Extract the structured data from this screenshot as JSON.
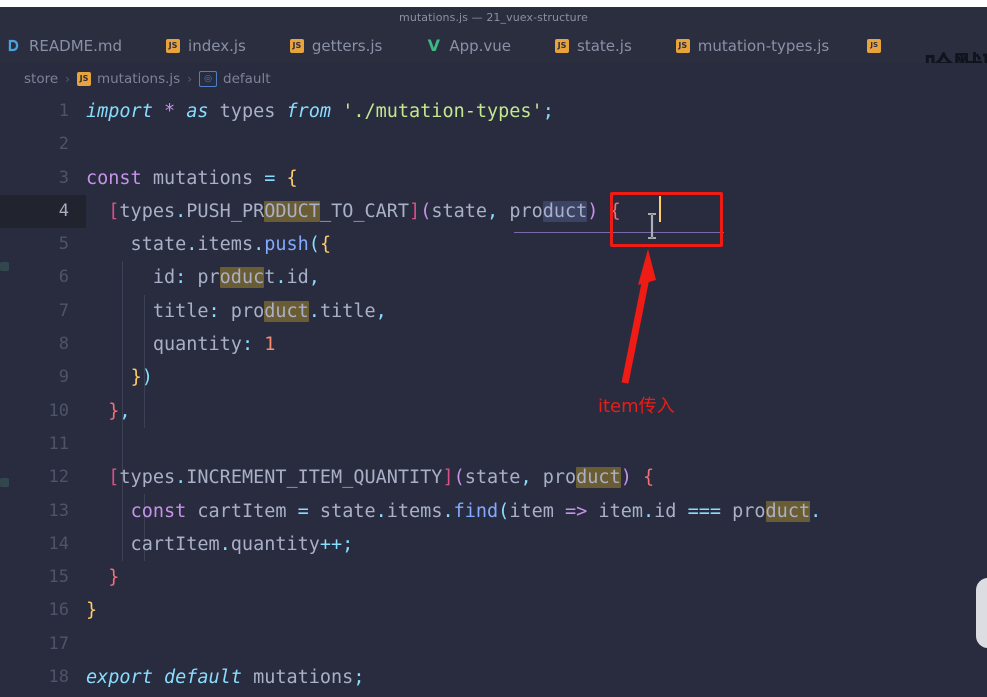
{
  "window": {
    "title": "mutations.js — 21_vuex-structure"
  },
  "tabs": [
    {
      "label": "README.md",
      "icon": "markdown-icon",
      "icon_text": "",
      "active": false
    },
    {
      "label": "index.js",
      "icon": "js-icon",
      "icon_text": "JS",
      "active": false
    },
    {
      "label": "getters.js",
      "icon": "js-icon",
      "icon_text": "JS",
      "active": false
    },
    {
      "label": "App.vue",
      "icon": "vue-icon",
      "icon_text": "V",
      "active": false
    },
    {
      "label": "state.js",
      "icon": "js-icon",
      "icon_text": "JS",
      "active": false
    },
    {
      "label": "mutation-types.js",
      "icon": "js-icon",
      "icon_text": "JS",
      "active": false
    }
  ],
  "breadcrumb": {
    "separator": "›",
    "items": [
      {
        "label": "store",
        "icon": ""
      },
      {
        "label": "mutations.js",
        "icon": "js-icon",
        "icon_text": "JS"
      },
      {
        "label": "default",
        "icon": "object-icon",
        "icon_text": "◎"
      }
    ]
  },
  "editor": {
    "current_line": 4,
    "first_visible_line": 1,
    "lines": [
      {
        "n": "1",
        "text": "import * as types from './mutation-types';"
      },
      {
        "n": "2",
        "text": ""
      },
      {
        "n": "3",
        "text": "const mutations = {"
      },
      {
        "n": "4",
        "text": "  [types.PUSH_PRODUCT_TO_CART](state, product) {"
      },
      {
        "n": "5",
        "text": "    state.items.push({"
      },
      {
        "n": "6",
        "text": "      id: product.id,"
      },
      {
        "n": "7",
        "text": "      title: product.title,"
      },
      {
        "n": "8",
        "text": "      quantity: 1"
      },
      {
        "n": "9",
        "text": "    })"
      },
      {
        "n": "10",
        "text": "  },"
      },
      {
        "n": "11",
        "text": ""
      },
      {
        "n": "12",
        "text": "  [types.INCREMENT_ITEM_QUANTITY](state, product) {"
      },
      {
        "n": "13",
        "text": "    const cartItem = state.items.find(item => item.id === product."
      },
      {
        "n": "14",
        "text": "    cartItem.quantity++;"
      },
      {
        "n": "15",
        "text": "  }"
      },
      {
        "n": "16",
        "text": "}"
      },
      {
        "n": "17",
        "text": ""
      },
      {
        "n": "18",
        "text": "export default mutations;"
      }
    ]
  },
  "annotation": {
    "label": "item传入",
    "color": "#ee1c15",
    "box_target": "product-parameter"
  },
  "watermark": {
    "text": "哈默聊"
  },
  "colors": {
    "background": "#282c3e",
    "chrome": "#2a2e3f",
    "current_line": "#21242f",
    "gutter_text": "#4e5468",
    "plain_text": "#a9b0c7",
    "keyword": "#89ddff",
    "keyword_alt": "#c792ea",
    "string": "#c3e88d",
    "number": "#f78c6c",
    "function": "#82aaff",
    "brace": "#ffcb6b",
    "bracket": "#f07178",
    "occurrence_highlight": "#6b5d33",
    "selection": "#3c4466",
    "caret": "#ffcc66",
    "annotation_red": "#ee1c15",
    "js_icon": "#e8a33d",
    "vue_icon": "#3fb984"
  }
}
